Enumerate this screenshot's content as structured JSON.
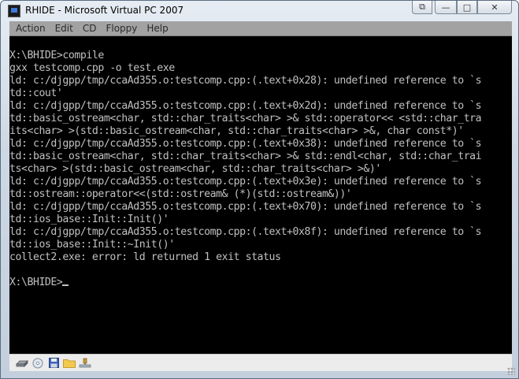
{
  "window": {
    "title": "RHIDE - Microsoft Virtual PC 2007",
    "controls": {
      "minimize": "—",
      "maximize": "□",
      "close": "✕",
      "extra": "⧉"
    }
  },
  "menubar": {
    "items": [
      {
        "label": "Action"
      },
      {
        "label": "Edit"
      },
      {
        "label": "CD"
      },
      {
        "label": "Floppy"
      },
      {
        "label": "Help"
      }
    ]
  },
  "console": {
    "lines": [
      "X:\\BHIDE>compile",
      "gxx testcomp.cpp -o test.exe",
      "ld: c:/djgpp/tmp/ccaAd355.o:testcomp.cpp:(.text+0x28): undefined reference to `s",
      "td::cout'",
      "ld: c:/djgpp/tmp/ccaAd355.o:testcomp.cpp:(.text+0x2d): undefined reference to `s",
      "td::basic_ostream<char, std::char_traits<char> >& std::operator<< <std::char_tra",
      "its<char> >(std::basic_ostream<char, std::char_traits<char> >&, char const*)'",
      "ld: c:/djgpp/tmp/ccaAd355.o:testcomp.cpp:(.text+0x38): undefined reference to `s",
      "td::basic_ostream<char, std::char_traits<char> >& std::endl<char, std::char_trai",
      "ts<char> >(std::basic_ostream<char, std::char_traits<char> >&)'",
      "ld: c:/djgpp/tmp/ccaAd355.o:testcomp.cpp:(.text+0x3e): undefined reference to `s",
      "td::ostream::operator<<(std::ostream& (*)(std::ostream&))'",
      "ld: c:/djgpp/tmp/ccaAd355.o:testcomp.cpp:(.text+0x70): undefined reference to `s",
      "td::ios_base::Init::Init()'",
      "ld: c:/djgpp/tmp/ccaAd355.o:testcomp.cpp:(.text+0x8f): undefined reference to `s",
      "td::ios_base::Init::~Init()'",
      "collect2.exe: error: ld returned 1 exit status",
      ""
    ],
    "prompt": "X:\\BHIDE>"
  },
  "statusbar": {
    "icons": [
      "hard-disk-icon",
      "cd-drive-icon",
      "floppy-disk-icon",
      "shared-folder-icon",
      "network-icon"
    ]
  },
  "colors": {
    "console_bg": "#000000",
    "console_fg": "#c0c0c0",
    "menubar_bg": "#a2a2a2"
  }
}
